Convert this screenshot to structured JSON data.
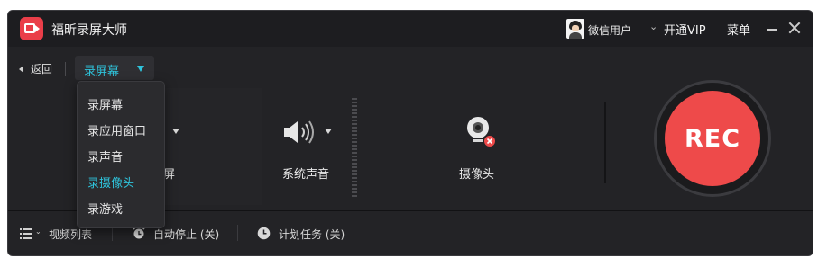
{
  "app": {
    "title": "福昕录屏大师"
  },
  "header": {
    "user_name": "微信用户",
    "vip_label": "开通VIP",
    "vip_chevron": "⌄",
    "menu_label": "菜单"
  },
  "nav": {
    "back_label": "返回",
    "mode_selected": "录屏幕"
  },
  "mode_dropdown": {
    "items": [
      "录屏幕",
      "录应用窗口",
      "录声音",
      "录摄像头",
      "录游戏"
    ],
    "highlighted_index": 3
  },
  "sources": {
    "screen_label_partial": "屏",
    "system_audio_label": "系统声音",
    "webcam_label": "摄像头",
    "webcam_status": "off"
  },
  "record": {
    "button_label": "REC"
  },
  "bottom_bar": {
    "video_list_label": "视频列表",
    "auto_stop_label": "自动停止 (关)",
    "schedule_label": "计划任务 (关)"
  },
  "colors": {
    "accent": "#2fc4dc",
    "record_red": "#ee4a4a",
    "brand_red": "#ea3e49",
    "window_bg": "#232326"
  },
  "icons": {
    "app_logo": "video-camera-logo-icon",
    "avatar": "user-avatar-icon",
    "speaker": "speaker-icon",
    "webcam": "webcam-icon",
    "list": "list-icon",
    "alarm": "alarm-clock-icon",
    "schedule": "clock-icon"
  }
}
